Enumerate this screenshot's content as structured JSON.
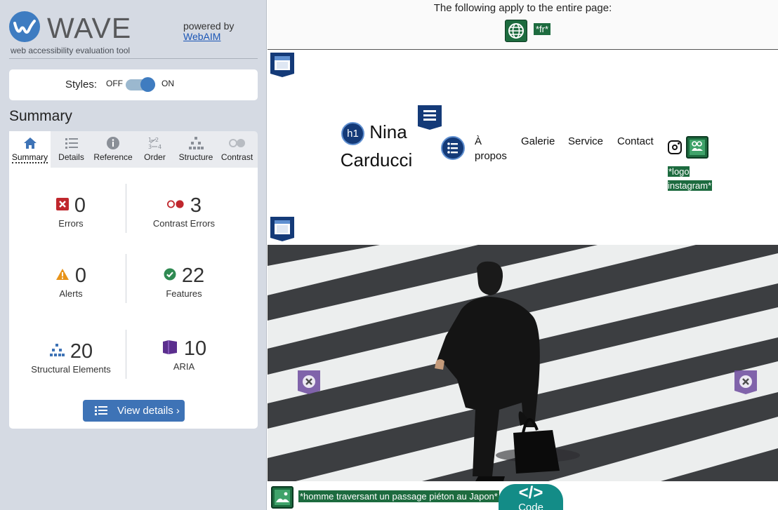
{
  "wave": {
    "title": "WAVE",
    "subtitle": "web accessibility evaluation tool",
    "powered_by": "powered by",
    "webaim_link": "WebAIM"
  },
  "styles_toggle": {
    "label": "Styles:",
    "off": "OFF",
    "on": "ON",
    "state": "on"
  },
  "summary": {
    "heading": "Summary",
    "tabs": [
      {
        "label": "Summary",
        "icon": "home-icon",
        "active": true
      },
      {
        "label": "Details",
        "icon": "list-icon",
        "active": false
      },
      {
        "label": "Reference",
        "icon": "info-icon",
        "active": false
      },
      {
        "label": "Order",
        "icon": "order-icon",
        "active": false
      },
      {
        "label": "Structure",
        "icon": "hierarchy-icon",
        "active": false
      },
      {
        "label": "Contrast",
        "icon": "contrast-icon",
        "active": false
      }
    ],
    "stats": {
      "errors": {
        "count": "0",
        "label": "Errors",
        "color": "#c0272d"
      },
      "contrast_errors": {
        "count": "3",
        "label": "Contrast Errors",
        "color": "#c0272d"
      },
      "alerts": {
        "count": "0",
        "label": "Alerts",
        "color": "#e8941a"
      },
      "features": {
        "count": "22",
        "label": "Features",
        "color": "#2f8a52"
      },
      "structural": {
        "count": "20",
        "label": "Structural Elements",
        "color": "#3e73b6"
      },
      "aria": {
        "count": "10",
        "label": "ARIA",
        "color": "#5b2e8e"
      }
    },
    "view_details": "View details ›"
  },
  "page": {
    "page_wide_text": "The following apply to the entire page:",
    "lang_badge": "*fr*",
    "site_heading_badge": "h1",
    "site_name": "Nina Carducci",
    "nav": [
      "À propos",
      "Galerie",
      "Service",
      "Contact"
    ],
    "logo_alt": "*logo instagram*",
    "hero_alt": "*homme traversant un passage piéton au Japon*",
    "code_button": "Code"
  },
  "colors": {
    "accent": "#3e73b6",
    "feature_green": "#1d6b3f",
    "structure_navy": "#143a78",
    "aria_purple": "#5b2e8e",
    "code_teal": "#138c87"
  }
}
